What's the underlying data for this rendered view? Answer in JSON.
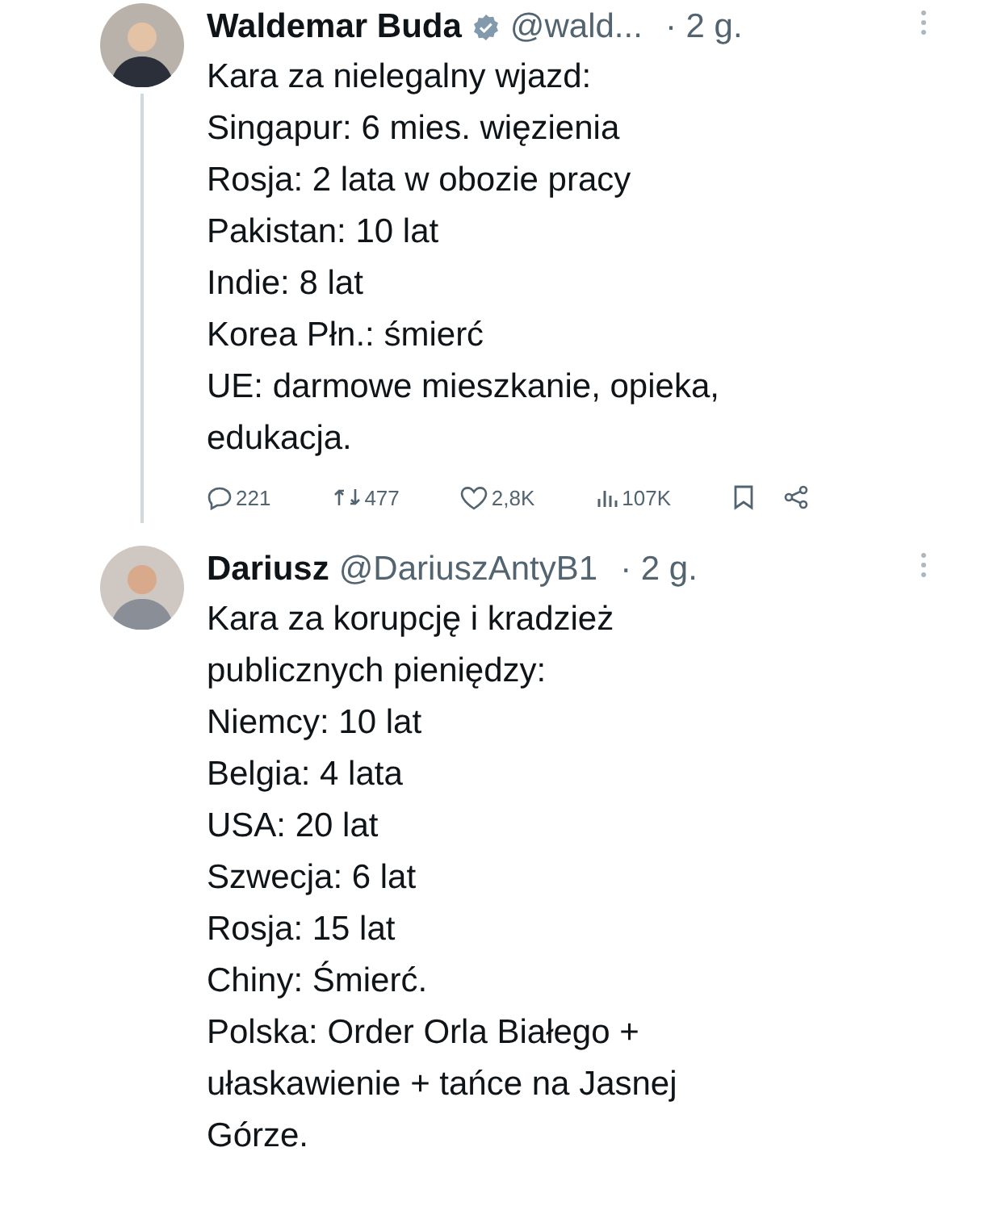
{
  "tweets": [
    {
      "name": "Waldemar Buda",
      "verified": true,
      "handle": "@wald...",
      "time": "· 2 g.",
      "thread": true,
      "lines": [
        "Kara za nielegalny wjazd:",
        "Singapur: 6 mies. więzienia",
        "Rosja: 2 lata w obozie pracy",
        "Pakistan: 10 lat",
        "Indie: 8 lat",
        "Korea Płn.: śmierć",
        "UE: darmowe mieszkanie, opieka,",
        "edukacja."
      ],
      "actions": [
        {
          "kind": "reply",
          "count": "221"
        },
        {
          "kind": "repost",
          "count": "477"
        },
        {
          "kind": "like",
          "count": "2,8K"
        },
        {
          "kind": "views",
          "count": "107K"
        },
        {
          "kind": "bookmark"
        },
        {
          "kind": "share"
        }
      ]
    },
    {
      "name": "Dariusz",
      "verified": false,
      "handle": "@DariuszAntyB1",
      "time": "· 2 g.",
      "thread": false,
      "lines": [
        "Kara za korupcję i kradzież",
        "publicznych pieniędzy:",
        "Niemcy: 10 lat",
        "Belgia: 4 lata",
        "USA: 20 lat",
        "Szwecja: 6 lat",
        "Rosja: 15 lat",
        "Chiny: Śmierć.",
        "Polska: Order Orla Białego +",
        "ułaskawienie + tańce na Jasnej",
        "Górze."
      ]
    }
  ]
}
